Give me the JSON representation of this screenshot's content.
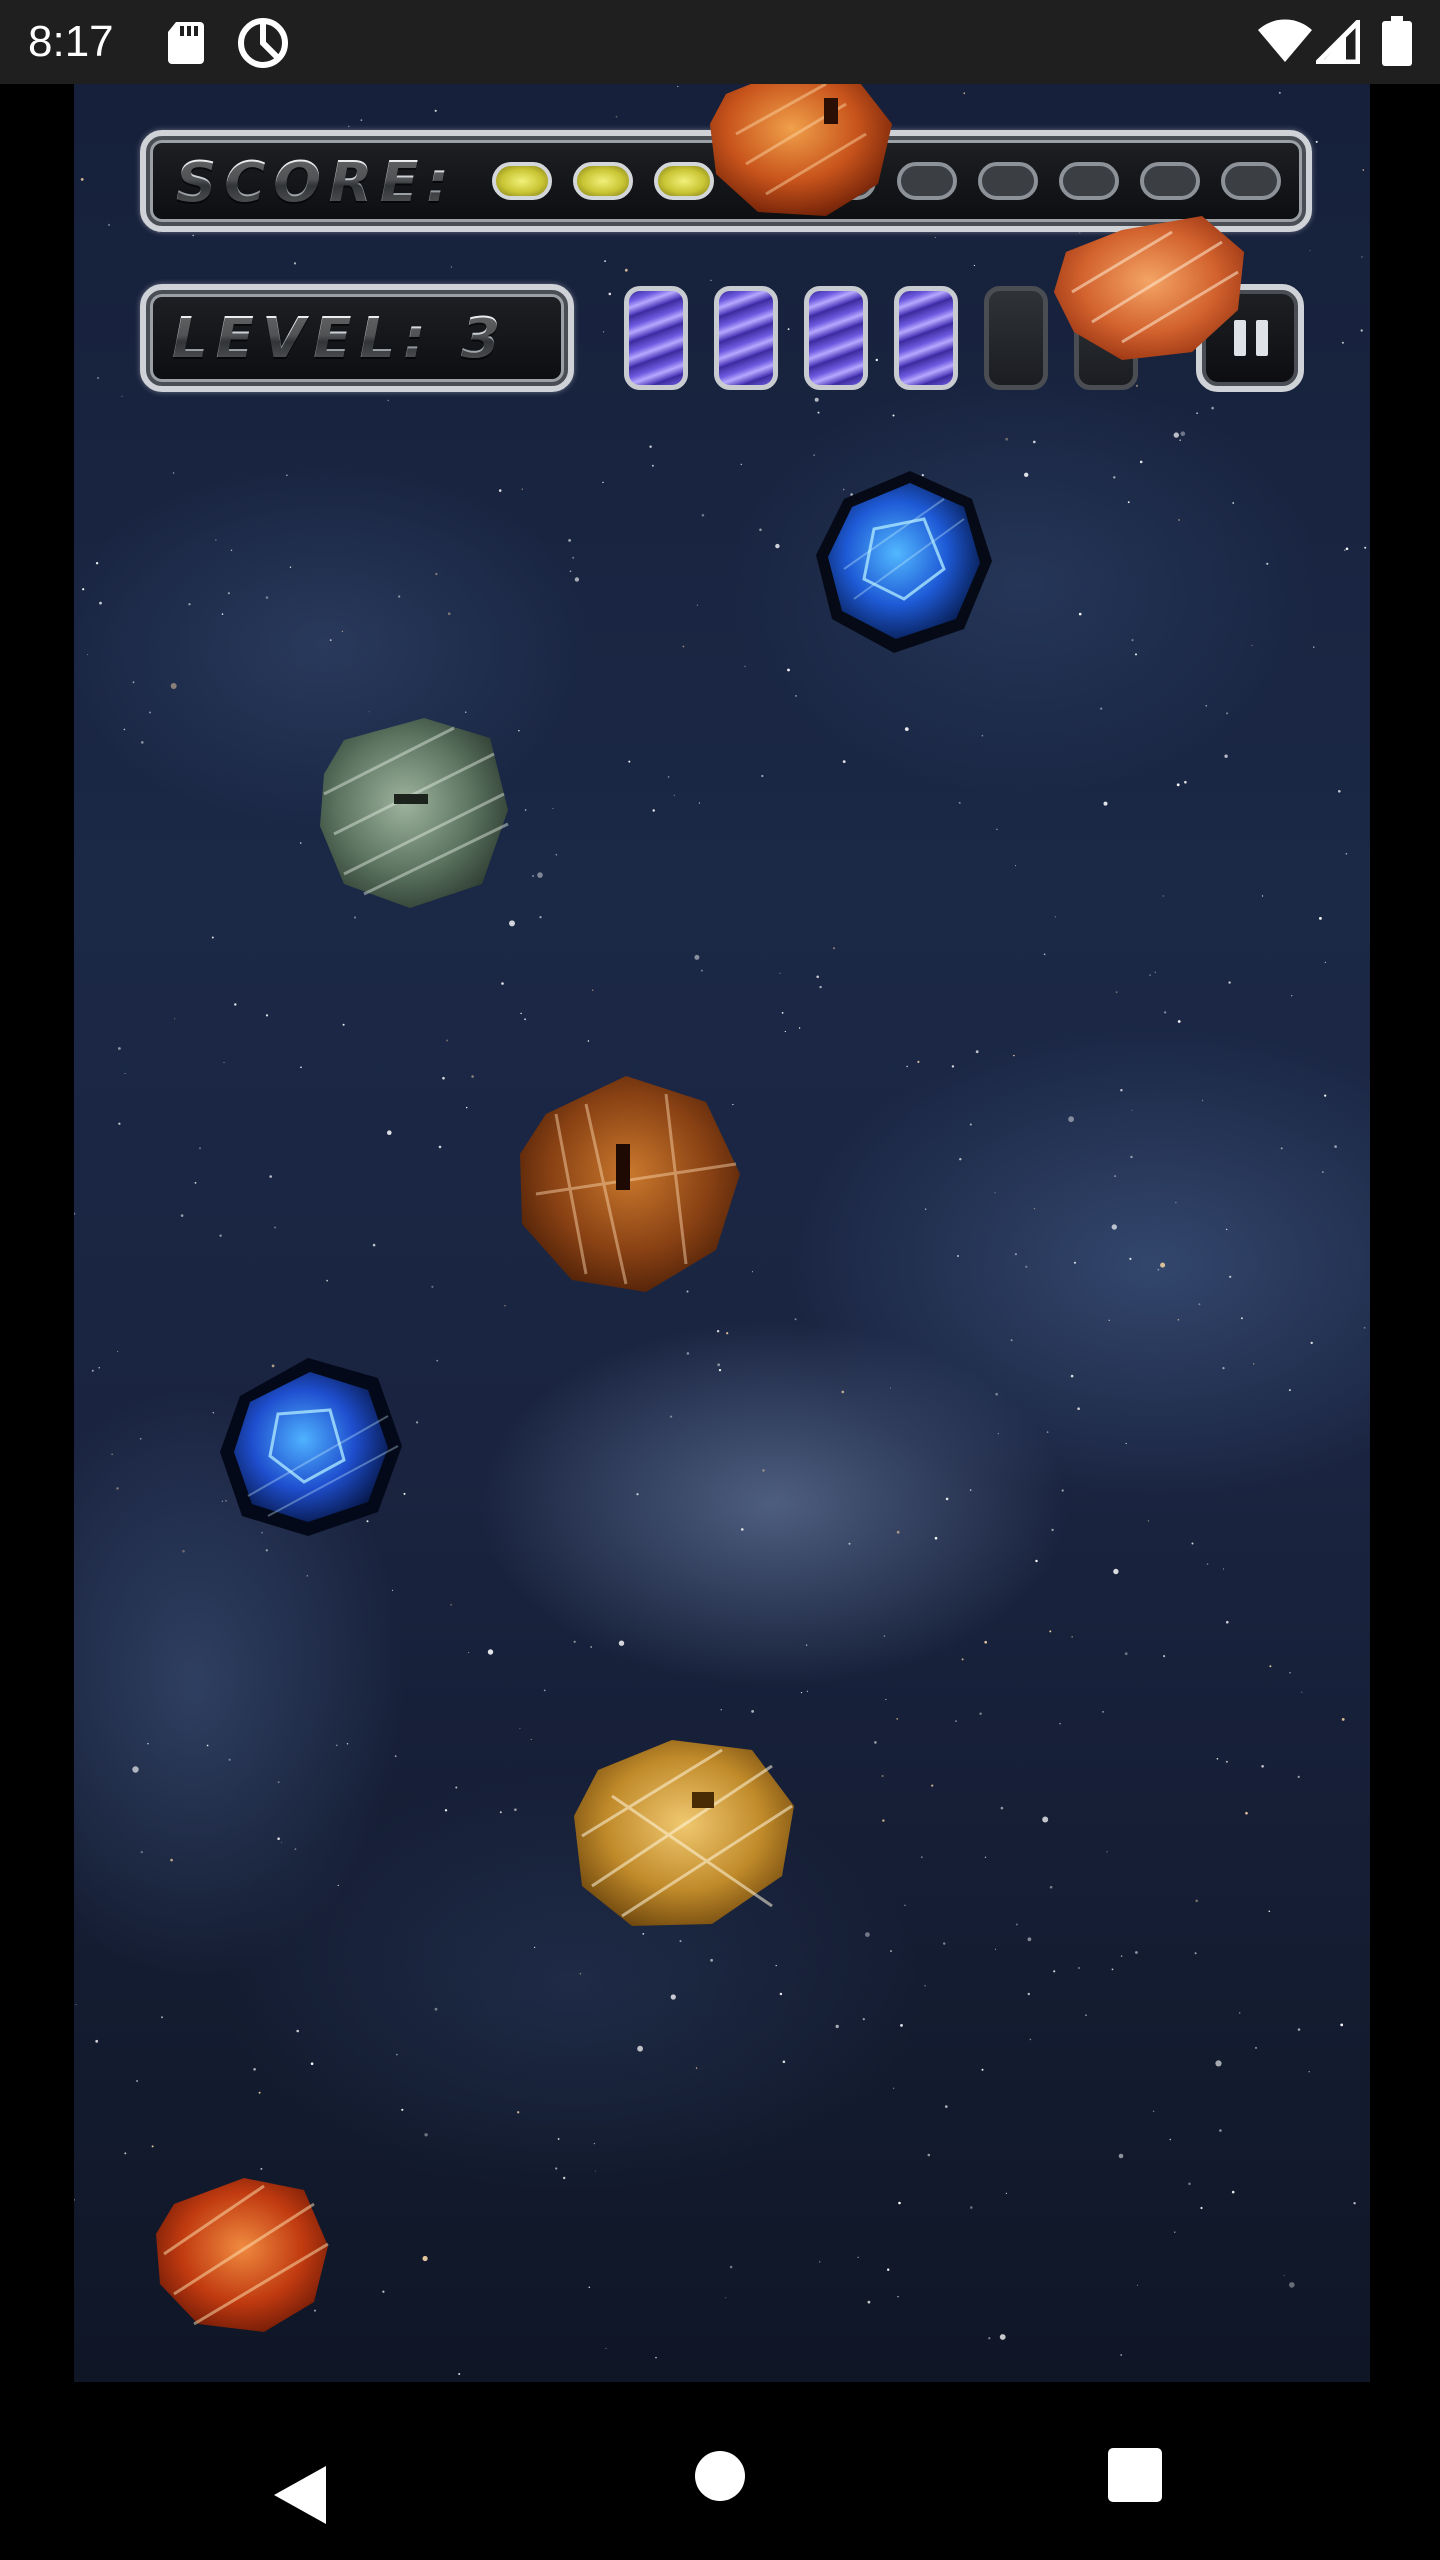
{
  "status_bar": {
    "time": "8:17",
    "icons": [
      "sd-card-icon",
      "data-saver-icon",
      "wifi-icon",
      "cell-signal-icon",
      "battery-icon"
    ]
  },
  "hud": {
    "score_label": "SCORE:",
    "score_pips_total": 10,
    "score_pips_lit": 3,
    "level_label": "LEVEL: 3",
    "level": 3,
    "lives_total": 6,
    "lives_remaining": 4,
    "pause_icon": "pause-icon"
  },
  "asteroids": [
    {
      "kind": "orange-rock",
      "color": "#c8541c"
    },
    {
      "kind": "orange-rock",
      "color": "#d2622e"
    },
    {
      "kind": "blue-crystal",
      "color": "#1e5ad6"
    },
    {
      "kind": "green-rock",
      "color": "#5c7460"
    },
    {
      "kind": "brown-rock",
      "color": "#8a4214"
    },
    {
      "kind": "blue-crystal",
      "color": "#1f4fcf"
    },
    {
      "kind": "gold-rock",
      "color": "#c08a2a"
    },
    {
      "kind": "red-rock",
      "color": "#c03a10"
    }
  ],
  "nav_bar": {
    "icons": [
      "back-icon",
      "home-icon",
      "recents-icon"
    ]
  }
}
